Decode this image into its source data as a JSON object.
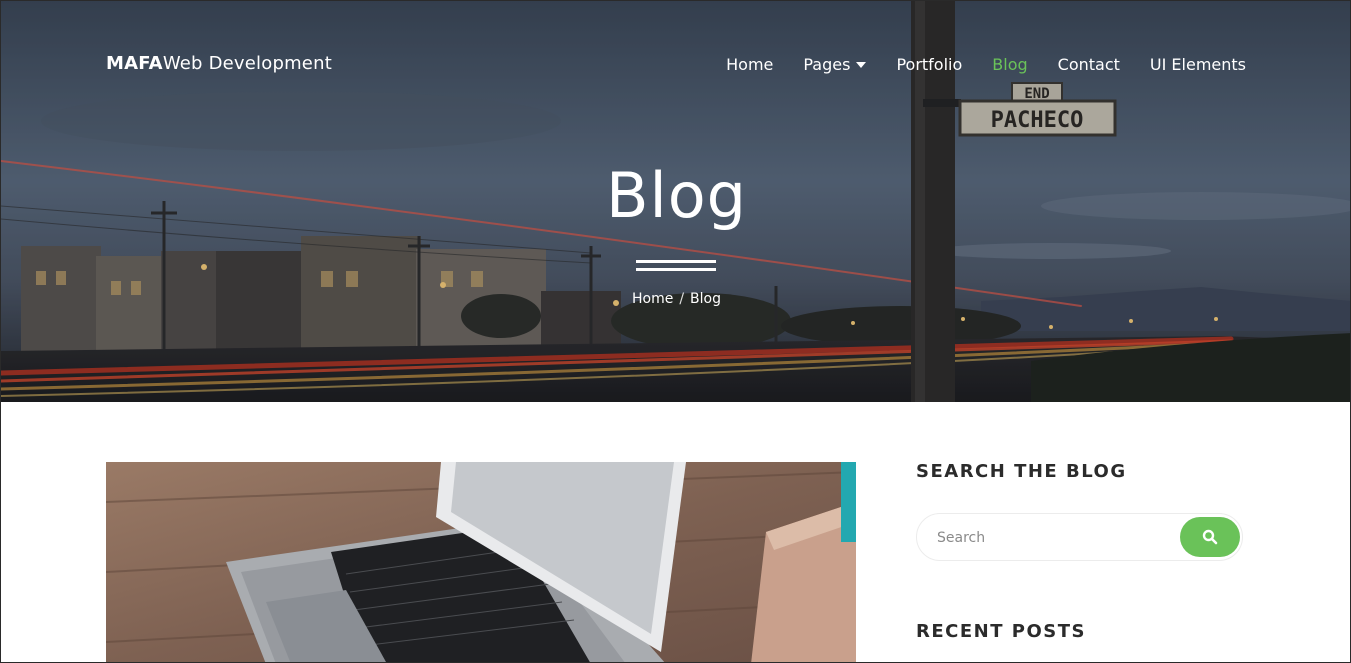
{
  "header": {
    "brand_bold": "MAFA",
    "brand_light": "Web Development",
    "nav": [
      {
        "label": "Home",
        "active": false
      },
      {
        "label": "Pages",
        "active": false,
        "dropdown": true
      },
      {
        "label": "Portfolio",
        "active": false
      },
      {
        "label": "Blog",
        "active": true
      },
      {
        "label": "Contact",
        "active": false
      },
      {
        "label": "UI Elements",
        "active": false
      }
    ]
  },
  "hero": {
    "title": "Blog",
    "breadcrumb": {
      "home": "Home",
      "separator": "/",
      "current": "Blog"
    },
    "street_sign": {
      "top": "END",
      "main": "PACHECO"
    }
  },
  "sidebar": {
    "search": {
      "title": "SEARCH THE BLOG",
      "placeholder": "Search",
      "icon": "search-icon"
    },
    "recent": {
      "title": "RECENT POSTS"
    }
  },
  "colors": {
    "accent": "#6ac259",
    "white": "#ffffff",
    "heading": "#2b2b2b"
  }
}
